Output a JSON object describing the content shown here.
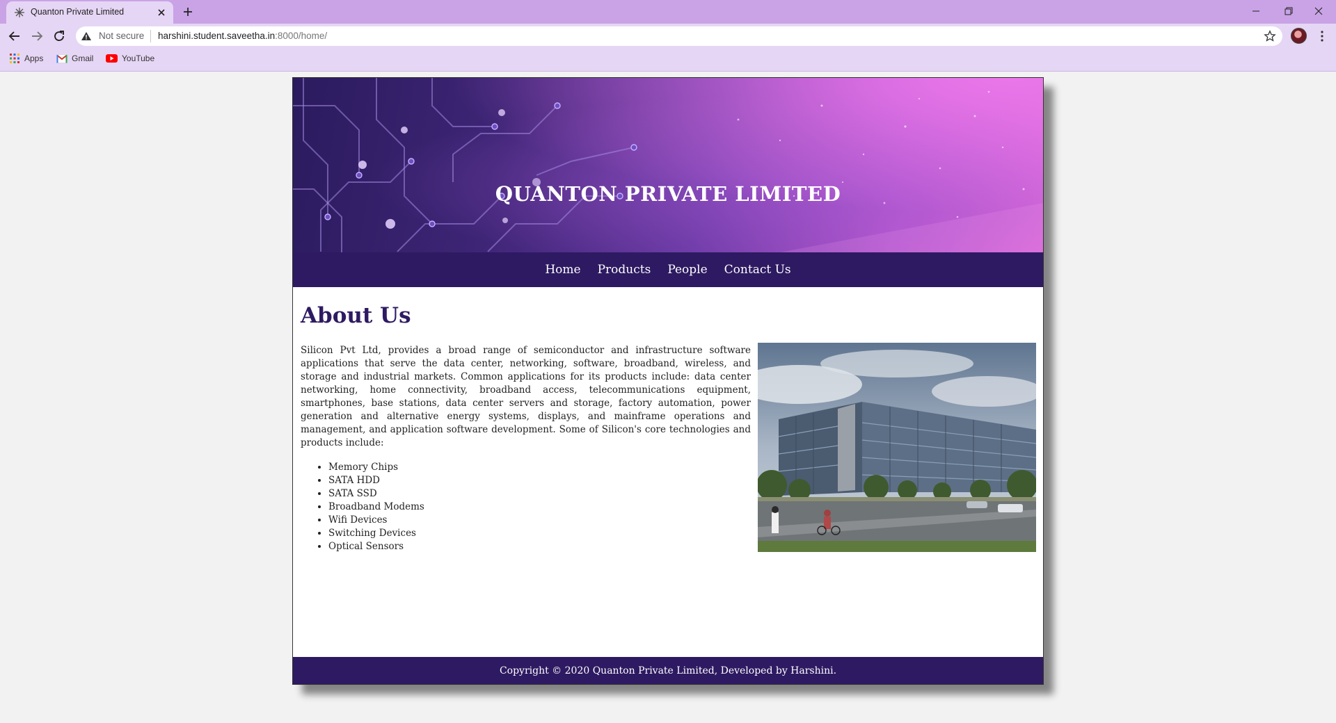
{
  "browser": {
    "tab_title": "Quanton Private Limited",
    "security_label": "Not secure",
    "url_host": "harshini.student.saveetha.in",
    "url_rest": ":8000/home/",
    "bookmarks": [
      {
        "label": "Apps",
        "icon": "apps-grid-icon"
      },
      {
        "label": "Gmail",
        "icon": "gmail-icon"
      },
      {
        "label": "YouTube",
        "icon": "youtube-icon"
      }
    ]
  },
  "site": {
    "banner_title": "QUANTON PRIVATE LIMITED",
    "nav": [
      "Home",
      "Products",
      "People",
      "Contact Us"
    ],
    "about_title": "About Us",
    "about_text": "Silicon Pvt Ltd, provides a broad range of semiconductor and infrastructure software applications that serve the data center, networking, software, broadband, wireless, and storage and industrial markets. Common applications for its products include: data center networking, home connectivity, broadband access, telecommunications equipment, smartphones, base stations, data center servers and storage, factory automation, power generation and alternative energy systems, displays, and mainframe operations and management, and application software development. Some of Silicon's core technologies and products include:",
    "features": [
      "Memory Chips",
      "SATA HDD",
      "SATA SSD",
      "Broadband Modems",
      "Wifi Devices",
      "Switching Devices",
      "Optical Sensors"
    ],
    "footer": "Copyright © 2020 Quanton Private Limited, Developed by Harshini."
  },
  "colors": {
    "nav_bg": "#2e1a62",
    "tabstrip": "#c9a3e6",
    "toolbar": "#e6d6f5",
    "heading": "#2e1a62"
  }
}
